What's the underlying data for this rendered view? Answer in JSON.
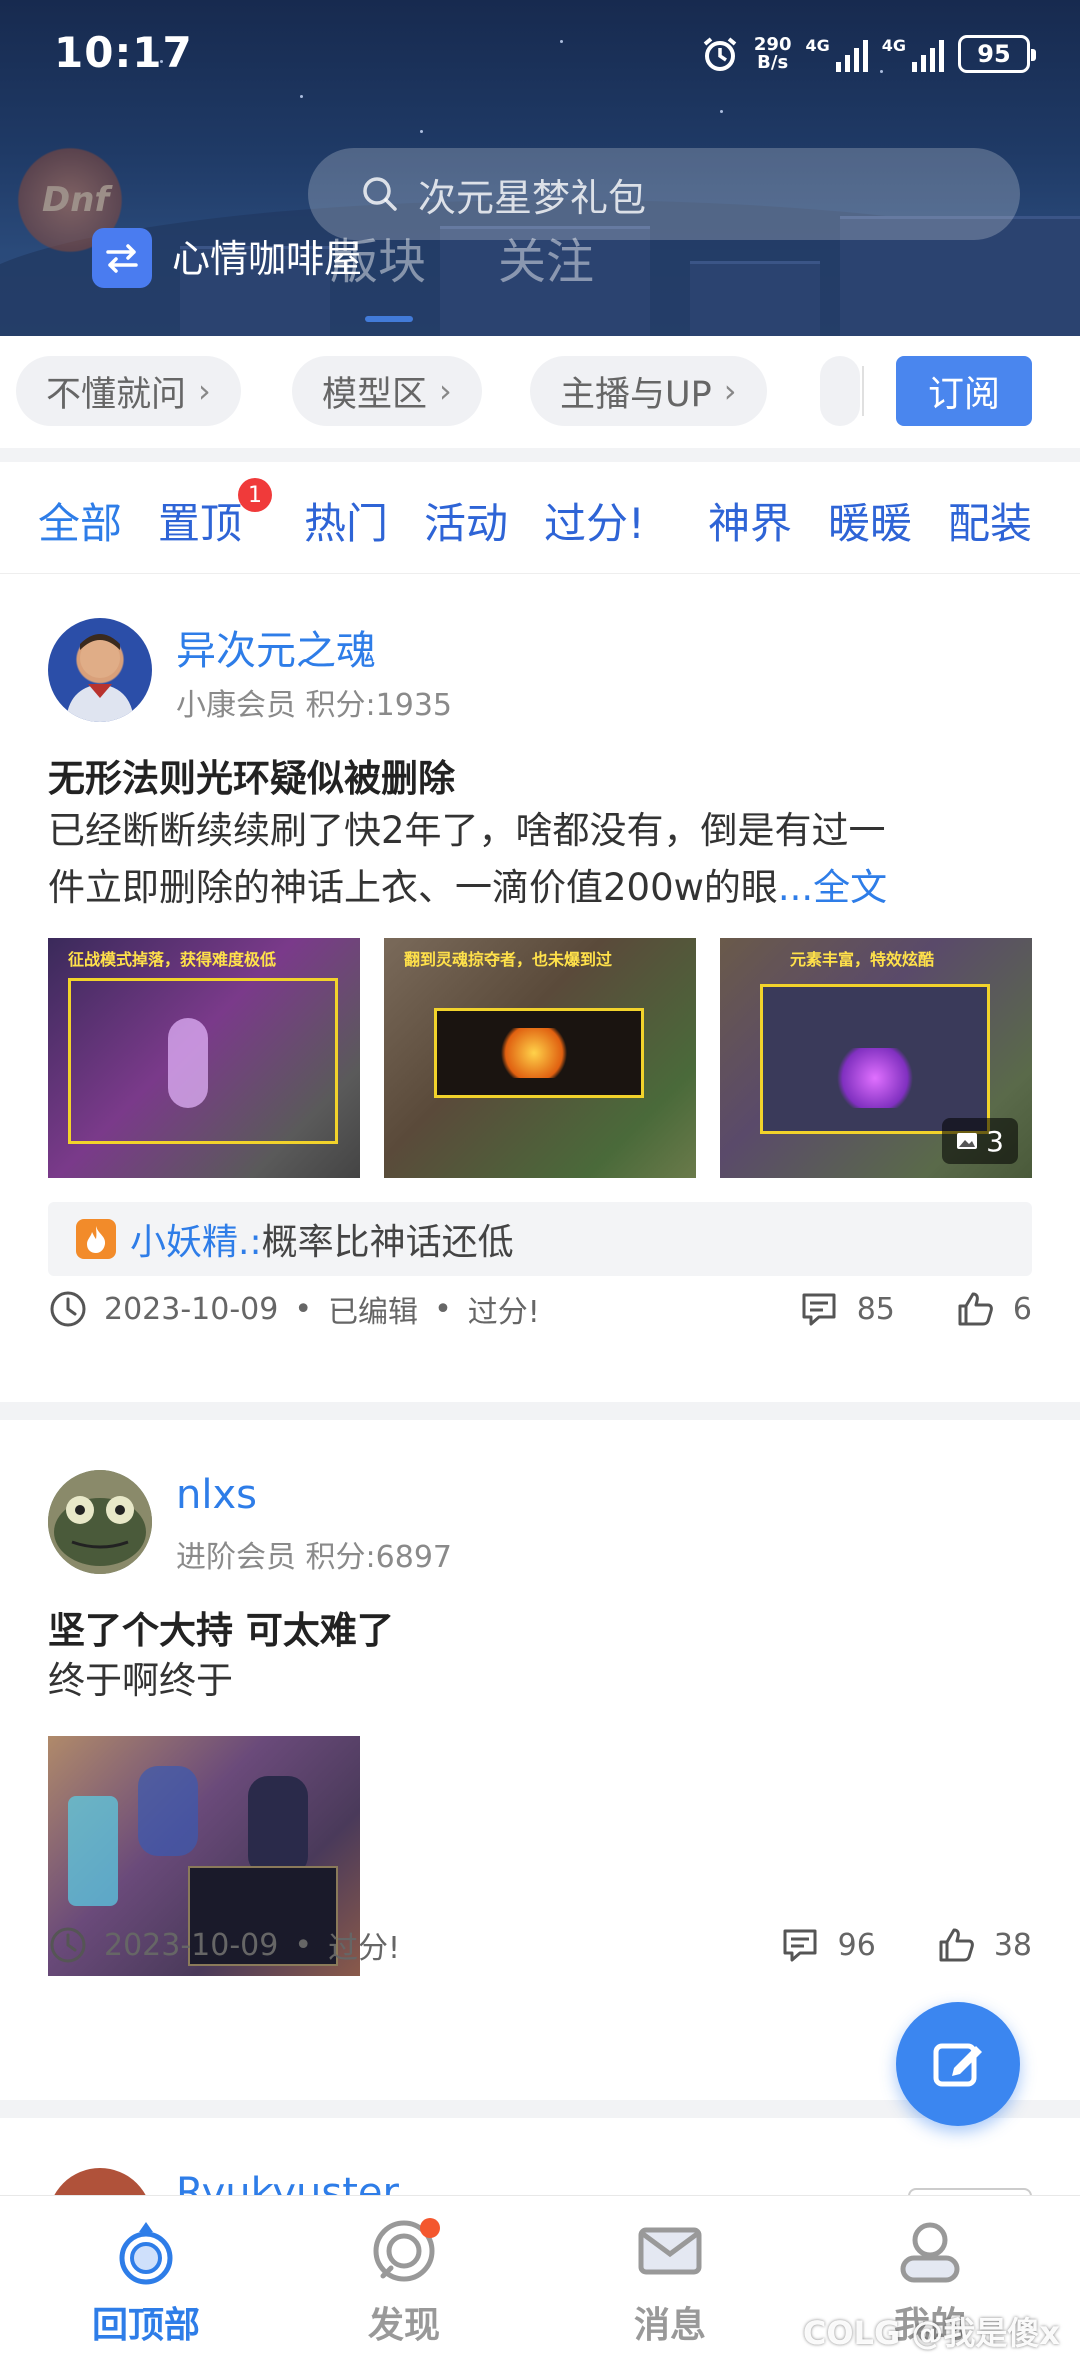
{
  "status_bar": {
    "time": "10:17",
    "net_speed_value": "290",
    "net_speed_unit": "B/s",
    "signal1": "4G",
    "signal2": "4G",
    "battery": "95"
  },
  "header": {
    "search_placeholder": "次元星梦礼包",
    "forum_name": "心情咖啡屋",
    "tabs": [
      {
        "label": "版块"
      },
      {
        "label": "关注"
      }
    ]
  },
  "categories": [
    {
      "label": "不懂就问"
    },
    {
      "label": "模型区"
    },
    {
      "label": "主播与UP"
    }
  ],
  "subscribe_label": "订阅",
  "filter_tabs": [
    {
      "label": "全部"
    },
    {
      "label": "置顶"
    },
    {
      "label": "热门"
    },
    {
      "label": "活动"
    },
    {
      "label": "过分!"
    },
    {
      "label": "神界"
    },
    {
      "label": "暖暖"
    },
    {
      "label": "配装"
    }
  ],
  "pinned_badge": "1",
  "posts": [
    {
      "username": "异次元之魂",
      "level": "小康会员",
      "points": "积分:1935",
      "title": "无形法则光环疑似被删除",
      "body_line1": " 已经断断续续刷了快2年了，啥都没有，倒是有过一",
      "body_line2": "件立即删除的神话上衣、一滴价值200w的眼",
      "more": "...全文",
      "image_captions": [
        "征战模式掉落，获得难度极低",
        "翻到灵魂掠夺者，也未爆到过",
        "元素丰富，特效炫酷"
      ],
      "image_count": "3",
      "comment_user": "小妖精.:",
      "comment_text": " 概率比神话还低",
      "date": "2023-10-09",
      "edited": "已编辑",
      "tag": "过分!",
      "comments": "85",
      "likes": "6"
    },
    {
      "username": "nlxs",
      "level": "进阶会员",
      "points": "积分:6897",
      "title": "坚了个大持 可太难了",
      "body_line1": "终于啊终于",
      "date": "2023-10-09",
      "tag": "过分!",
      "comments": "96",
      "likes": "38"
    },
    {
      "username": "Ryukyuster"
    }
  ],
  "bottom_nav": [
    {
      "label": "回顶部"
    },
    {
      "label": "发现"
    },
    {
      "label": "消息"
    },
    {
      "label": "我的"
    }
  ],
  "watermark": "COLG @我是傻x",
  "colors": {
    "accent": "#2e7de8",
    "badge": "#f03a3a",
    "fab": "#3b86f0"
  }
}
